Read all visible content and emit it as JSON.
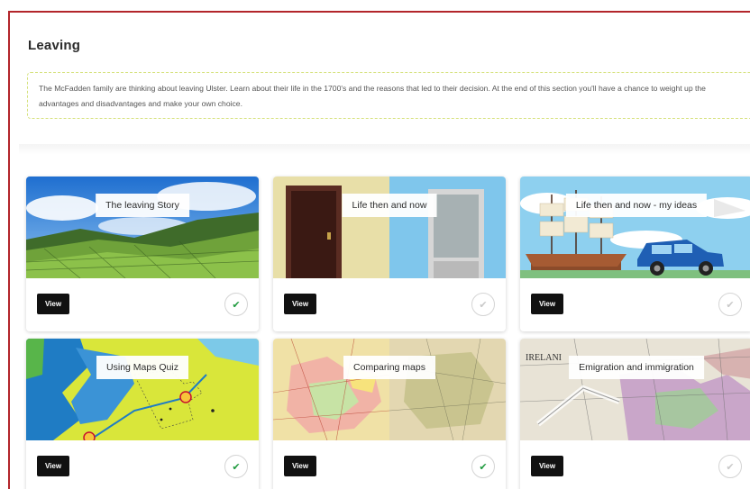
{
  "section": {
    "title": "Leaving",
    "intro": "The McFadden family are thinking about leaving Ulster. Learn about their life in the 1700's and the reasons that led to their decision. At the end of this section you'll have a chance to weight up the advantages and disadvantages and make your own choice."
  },
  "cards": [
    {
      "title": "The leaving Story",
      "view_label": "View",
      "completed": true,
      "status_icon": "check-icon"
    },
    {
      "title": "Life then and now",
      "view_label": "View",
      "completed": false,
      "status_icon": "check-icon"
    },
    {
      "title": "Life then and now - my ideas",
      "view_label": "View",
      "completed": false,
      "status_icon": "check-icon"
    },
    {
      "title": "Using Maps Quiz",
      "view_label": "View",
      "completed": true,
      "status_icon": "check-icon"
    },
    {
      "title": "Comparing maps",
      "view_label": "View",
      "completed": true,
      "status_icon": "check-icon"
    },
    {
      "title": "Emigration and immigration",
      "view_label": "View",
      "completed": false,
      "status_icon": "check-icon"
    }
  ],
  "art_text": {
    "old_map_label": "IRELANI"
  },
  "colors": {
    "frame_border": "#b3262b",
    "intro_border": "#d6e27e",
    "view_button": "#111111",
    "check_done": "#1f9a3e",
    "check_todo": "#c9c9c9"
  }
}
